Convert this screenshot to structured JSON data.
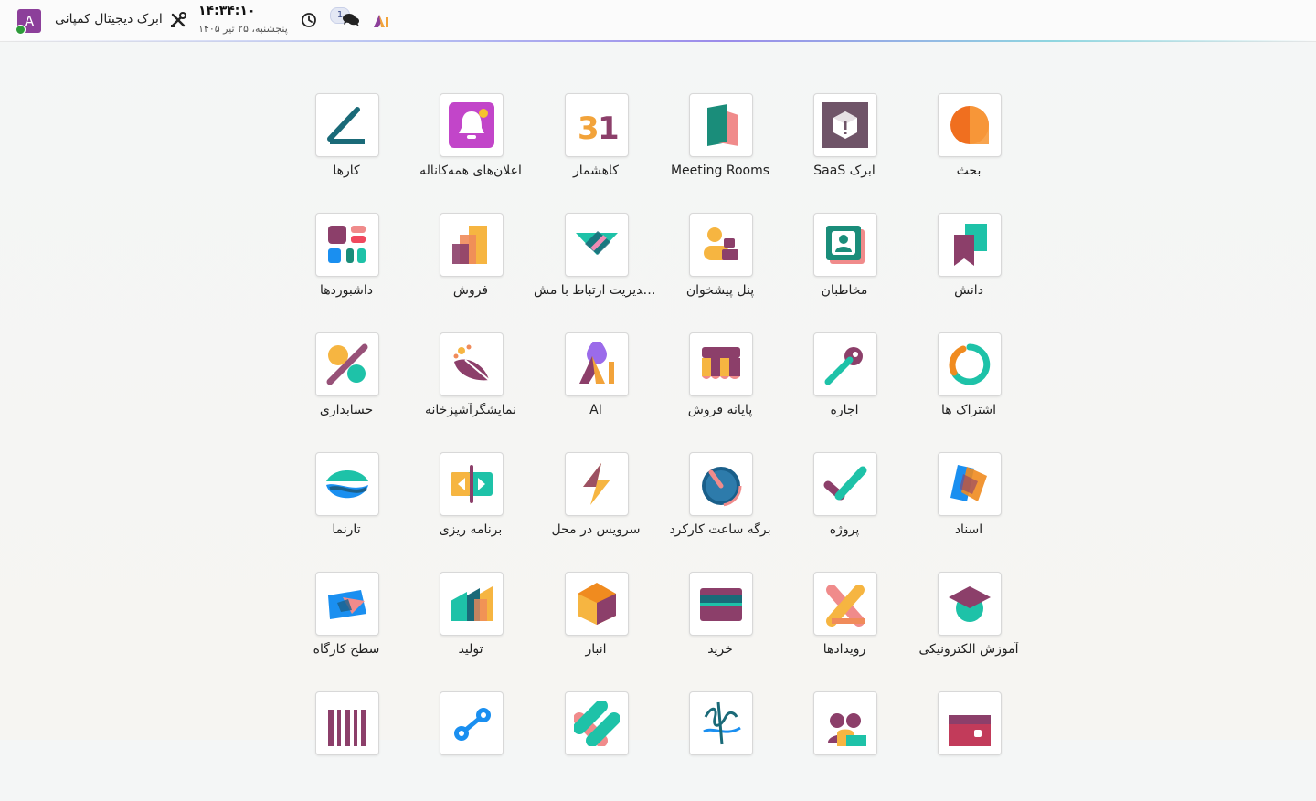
{
  "topbar": {
    "user_initial": "A",
    "company_name": "ابرک دیجیتال کمپانی",
    "clock_time": "۱۴:۳۴:۱۰",
    "clock_date": "پنجشنبه، ۲۵ تیر ۱۴۰۵",
    "chat_badge": "1",
    "icons": [
      "tools-icon",
      "history-icon",
      "chat-icon",
      "ai-icon"
    ]
  },
  "apps": [
    {
      "label": "بحث",
      "icon": "discuss-icon"
    },
    {
      "label": "SaaS ابرک",
      "icon": "saas-icon"
    },
    {
      "label": "Meeting Rooms",
      "icon": "meeting-rooms-icon"
    },
    {
      "label": "کاهشمار",
      "icon": "calendar-icon"
    },
    {
      "label": "اعلان‌های همه‌کاناله",
      "icon": "notification-icon"
    },
    {
      "label": "کارها",
      "icon": "todo-icon"
    },
    {
      "label": "دانش",
      "icon": "knowledge-icon"
    },
    {
      "label": "مخاطبان",
      "icon": "contacts-icon"
    },
    {
      "label": "پنل پیشخوان",
      "icon": "frontdesk-icon"
    },
    {
      "label": "مدیریت ارتباط با مش...",
      "icon": "crm-icon"
    },
    {
      "label": "فروش",
      "icon": "sales-icon"
    },
    {
      "label": "داشبوردها",
      "icon": "dashboards-icon"
    },
    {
      "label": "اشتراک ها",
      "icon": "subscriptions-icon"
    },
    {
      "label": "اجاره",
      "icon": "rental-icon"
    },
    {
      "label": "پایانه فروش",
      "icon": "pos-icon"
    },
    {
      "label": "AI",
      "icon": "ai-app-icon"
    },
    {
      "label": "نمایشگرآشپزخانه",
      "icon": "kitchen-display-icon"
    },
    {
      "label": "حسابداری",
      "icon": "accounting-icon"
    },
    {
      "label": "اسناد",
      "icon": "documents-icon"
    },
    {
      "label": "پروژه",
      "icon": "project-icon"
    },
    {
      "label": "برگه ساعت کارکرد",
      "icon": "timesheets-icon"
    },
    {
      "label": "سرویس در محل",
      "icon": "field-service-icon"
    },
    {
      "label": "برنامه ریزی",
      "icon": "planning-icon"
    },
    {
      "label": "تارنما",
      "icon": "website-icon"
    },
    {
      "label": "آموزش الکترونیکی",
      "icon": "elearning-icon"
    },
    {
      "label": "رویدادها",
      "icon": "events-icon"
    },
    {
      "label": "خرید",
      "icon": "purchase-icon"
    },
    {
      "label": "انبار",
      "icon": "inventory-icon"
    },
    {
      "label": "تولید",
      "icon": "manufacturing-icon"
    },
    {
      "label": "سطح کارگاه",
      "icon": "shop-floor-icon"
    },
    {
      "label": "",
      "icon": "barcode-icon"
    },
    {
      "label": "",
      "icon": "workflow-icon"
    },
    {
      "label": "",
      "icon": "repairs-icon"
    },
    {
      "label": "",
      "icon": "sign-icon"
    },
    {
      "label": "",
      "icon": "employees-icon"
    },
    {
      "label": "",
      "icon": "expenses-icon"
    }
  ],
  "colors": {
    "avatar": "#8c3f9a",
    "online": "#2e9b3a",
    "tile_bg": "#ffffff",
    "tile_border": "#d8d8d8"
  }
}
